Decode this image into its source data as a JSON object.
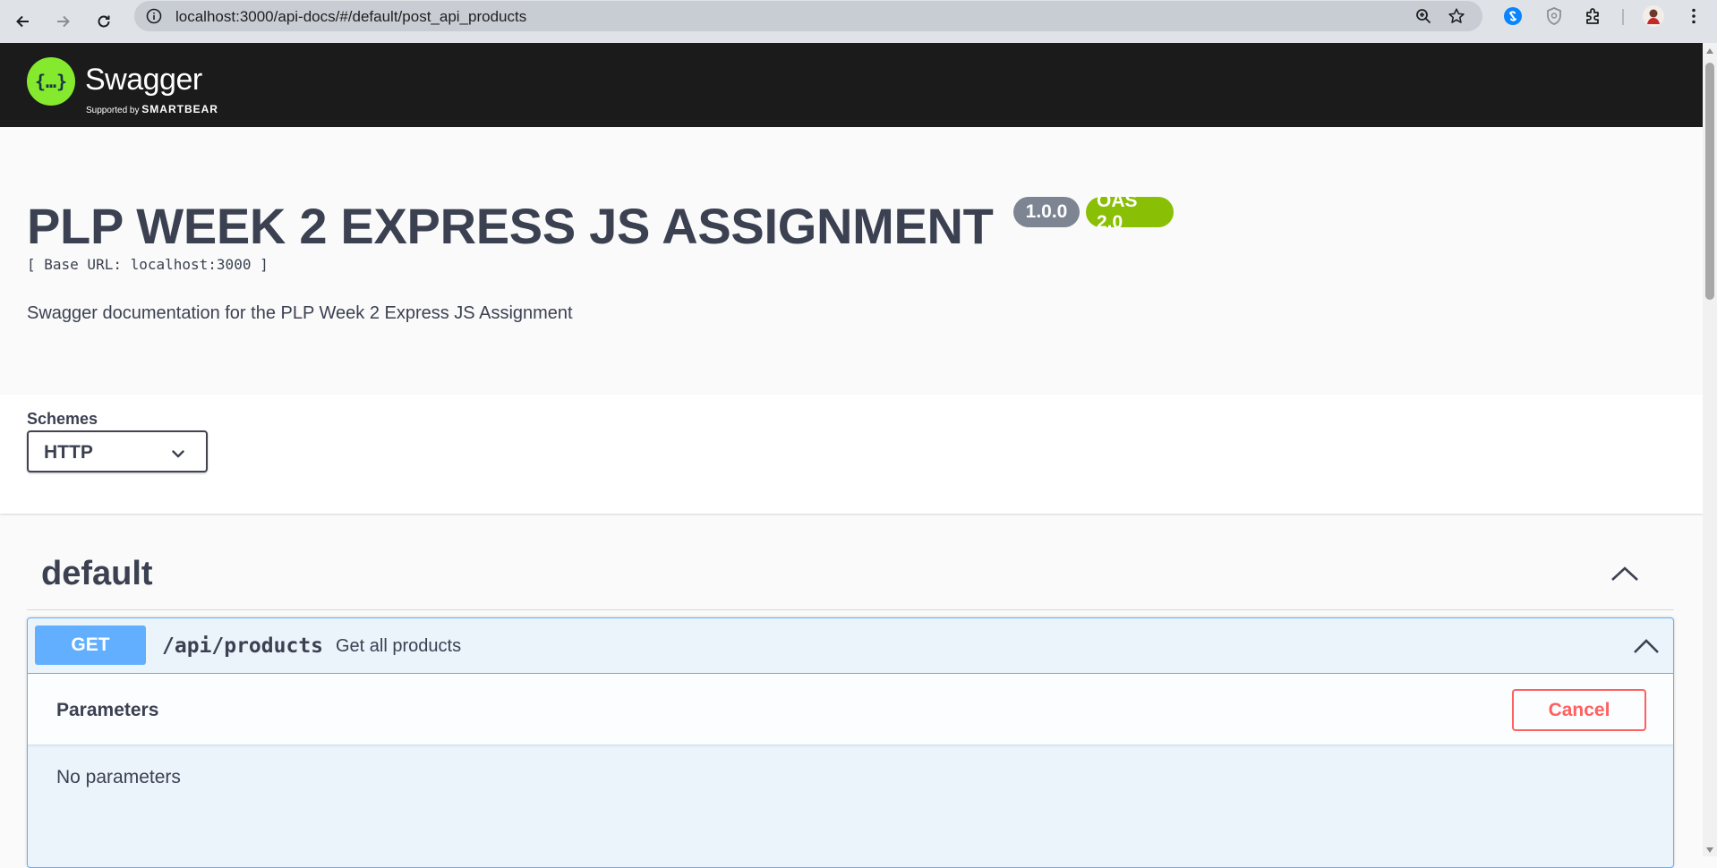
{
  "browser": {
    "url": "localhost:3000/api-docs/#/default/post_api_products"
  },
  "topbar": {
    "logo_glyph": "{…}",
    "brand": "Swagger",
    "supported_by": "Supported by",
    "supported_by_brand": "SMARTBEAR"
  },
  "info": {
    "title": "PLP WEEK 2 EXPRESS JS ASSIGNMENT",
    "version": "1.0.0",
    "oas": "OAS 2.0",
    "base_url": "[ Base URL: localhost:3000 ]",
    "description": "Swagger documentation for the PLP Week 2 Express JS Assignment"
  },
  "schemes": {
    "label": "Schemes",
    "selected": "HTTP"
  },
  "tag": {
    "name": "default"
  },
  "operation": {
    "method": "GET",
    "path": "/api/products",
    "summary": "Get all products",
    "parameters_title": "Parameters",
    "cancel_label": "Cancel",
    "no_parameters": "No parameters"
  },
  "colors": {
    "topbar_bg": "#1b1b1b",
    "logo_green": "#85ea2d",
    "get_blue": "#61affe",
    "get_bg": "#ebf3fb",
    "cancel_red": "#ff6060",
    "badge_version": "#7d8492",
    "badge_oas": "#89bf04",
    "text": "#3b4151"
  }
}
